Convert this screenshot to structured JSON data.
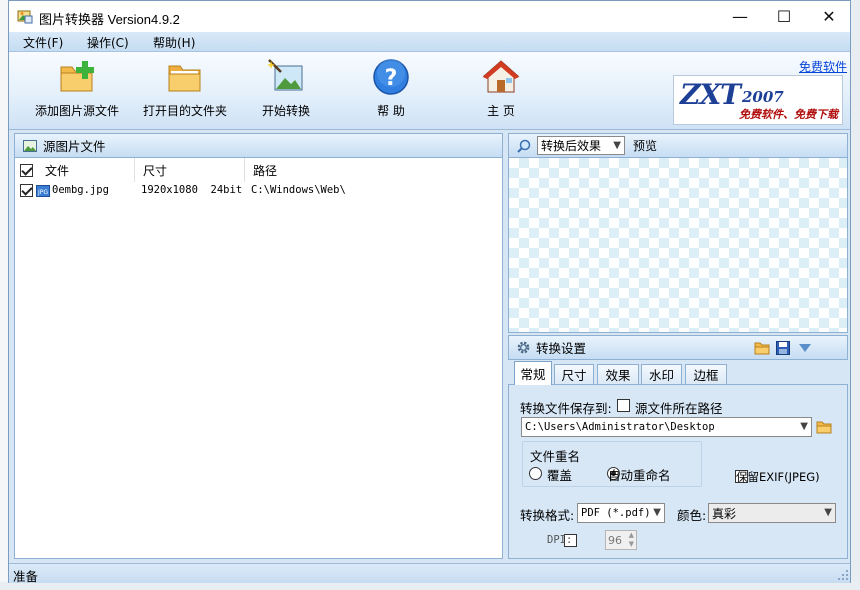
{
  "window": {
    "title": "图片转换器 Version4.9.2",
    "minimize": "—",
    "maximize": "☐",
    "close": "✕"
  },
  "menu": [
    "文件(F)",
    "操作(C)",
    "帮助(H)"
  ],
  "toolbar": {
    "buttons": [
      {
        "label": "添加图片源文件",
        "icon": "folder-add-icon"
      },
      {
        "label": "打开目的文件夹",
        "icon": "folder-open-icon"
      },
      {
        "label": "开始转换",
        "icon": "magic-wand-image-icon"
      },
      {
        "label": "帮 助",
        "icon": "help-icon"
      },
      {
        "label": "主 页",
        "icon": "home-icon"
      }
    ],
    "free_link": "免费软件",
    "logo_name": "ZXT",
    "logo_year": "2007",
    "logo_slogan": "免费软件、免费下载"
  },
  "source_panel": {
    "title": "源图片文件",
    "columns": [
      "文件",
      "尺寸",
      "路径"
    ],
    "rows": [
      {
        "checked": true,
        "file": "0embg.jpg",
        "size": "1920x1080  24bit",
        "path": "C:\\Windows\\Web\\"
      }
    ]
  },
  "preview_panel": {
    "mode_selected": "转换后效果",
    "label": "预览"
  },
  "settings_panel": {
    "title": "转换设置",
    "tabs": [
      "常规",
      "尺寸",
      "效果",
      "水印",
      "边框"
    ],
    "active_tab": "常规",
    "save_to_label": "转换文件保存到:",
    "source_path_checkbox": "源文件所在路径",
    "output_path": "C:\\Users\\Administrator\\Desktop",
    "rename_group": "文件重名",
    "rename_options": [
      "覆盖",
      "自动重命名"
    ],
    "rename_selected": "自动重命名",
    "keep_exif": "保留EXIF(JPEG)",
    "format_label": "转换格式:",
    "format_value": "PDF (*.pdf)",
    "color_label": "颜色:",
    "color_value": "真彩",
    "dpi_label": "DPI:",
    "dpi_value": "96"
  },
  "status": "准备",
  "colors": {
    "accent": "#1d3f96",
    "link": "#0645d8",
    "panel_border": "#8eb0d3"
  }
}
